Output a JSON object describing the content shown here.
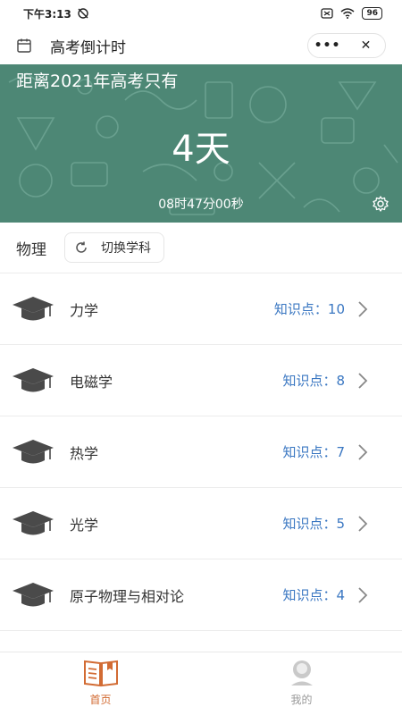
{
  "status_bar": {
    "time": "下午3:13",
    "battery": "96",
    "icons": [
      "do-not-disturb-icon",
      "sim-icon",
      "wifi-icon",
      "battery-icon"
    ]
  },
  "title_bar": {
    "title": "高考倒计时",
    "more_label": "•••",
    "close_label": "✕"
  },
  "banner": {
    "heading": "距离2021年高考只有",
    "days": "4天",
    "clock": "08时47分00秒",
    "background_color": "#4d8775"
  },
  "subject": {
    "name": "物理",
    "switch_label": "切换学科"
  },
  "topics": [
    {
      "name": "力学",
      "count": "知识点：10"
    },
    {
      "name": "电磁学",
      "count": "知识点：8"
    },
    {
      "name": "热学",
      "count": "知识点：7"
    },
    {
      "name": "光学",
      "count": "知识点：5"
    },
    {
      "name": "原子物理与相对论",
      "count": "知识点：4"
    }
  ],
  "bottom_nav": {
    "home_label": "首页",
    "mine_label": "我的",
    "active_color": "#d26b33"
  },
  "colors": {
    "accent_blue": "#3a77c2",
    "active_orange": "#d26b33"
  }
}
